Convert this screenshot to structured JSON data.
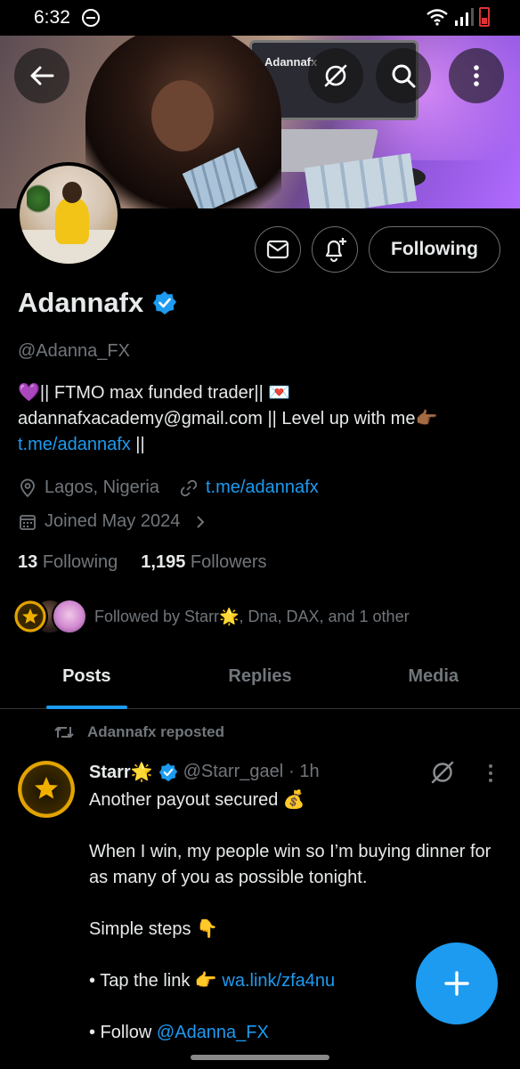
{
  "status_bar": {
    "time": "6:32"
  },
  "profile": {
    "display_name": "Adannafx",
    "handle": "@Adanna_FX",
    "verified": true,
    "banner_brand_text": "Adannafx",
    "bio_line1": "💜|| FTMO max funded trader||  💌",
    "bio_line2": "adannafxacademy@gmail.com || Level up with me👉🏾",
    "bio_link": "t.me/adannafx",
    "bio_link_suffix": " ||",
    "location": "Lagos, Nigeria",
    "website": "t.me/adannafx",
    "joined": "Joined May 2024",
    "following_count": "13",
    "following_label": "Following",
    "followers_count": "1,195",
    "followers_label": "Followers",
    "followed_by": "Followed by Starr🌟, Dna, DAX, and 1 other"
  },
  "actions": {
    "follow_label": "Following"
  },
  "tabs": [
    {
      "label": "Posts",
      "active": true
    },
    {
      "label": "Replies",
      "active": false
    },
    {
      "label": "Media",
      "active": false
    }
  ],
  "post": {
    "repost_label": "Adannafx reposted",
    "author_name": "Starr🌟",
    "author_handle": "@Starr_gael",
    "time": "· 1h",
    "line1": "Another payout secured 💰",
    "line2": "When I win, my people win so I’m buying dinner for as many of you as possible tonight.",
    "line3": "Simple steps 👇",
    "step1_prefix": "• Tap the link 👉 ",
    "step1_link": "wa.link/zfa4nu",
    "step2_prefix": "• Follow ",
    "step2_link": "@Adanna_FX"
  },
  "colors": {
    "accent": "#1d9bf0",
    "background": "#000000",
    "muted": "#71767b",
    "text": "#e7e9ea"
  },
  "icons": [
    "back-arrow-icon",
    "grok-icon",
    "search-icon",
    "more-vert-icon",
    "mail-icon",
    "bell-plus-icon",
    "location-icon",
    "link-icon",
    "calendar-icon",
    "chevron-right-icon",
    "repost-icon",
    "verified-icon",
    "plus-icon"
  ]
}
